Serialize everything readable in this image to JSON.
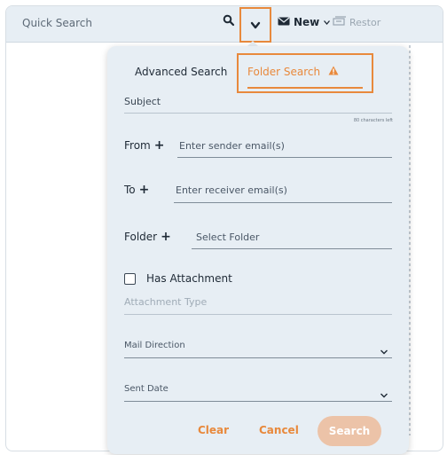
{
  "topbar": {
    "quick_search": "Quick Search",
    "new_label": "New",
    "restore_label": "Restor"
  },
  "panel": {
    "tabs": {
      "advanced": "Advanced Search",
      "folder": "Folder Search"
    },
    "subject": {
      "label": "Subject",
      "counter": "80 characters left"
    },
    "from": {
      "label": "From",
      "placeholder": "Enter sender email(s)"
    },
    "to": {
      "label": "To",
      "placeholder": "Enter receiver email(s)"
    },
    "folder": {
      "label": "Folder",
      "placeholder": "Select Folder"
    },
    "attachment": {
      "label": "Has Attachment",
      "checked": false,
      "type_placeholder": "Attachment Type"
    },
    "mail_direction": "Mail Direction",
    "sent_date": "Sent Date",
    "buttons": {
      "clear": "Clear",
      "cancel": "Cancel",
      "search": "Search"
    }
  },
  "colors": {
    "accent": "#e8893c",
    "panel_bg": "#e7eef4",
    "search_btn_bg": "#ecc3a8"
  }
}
